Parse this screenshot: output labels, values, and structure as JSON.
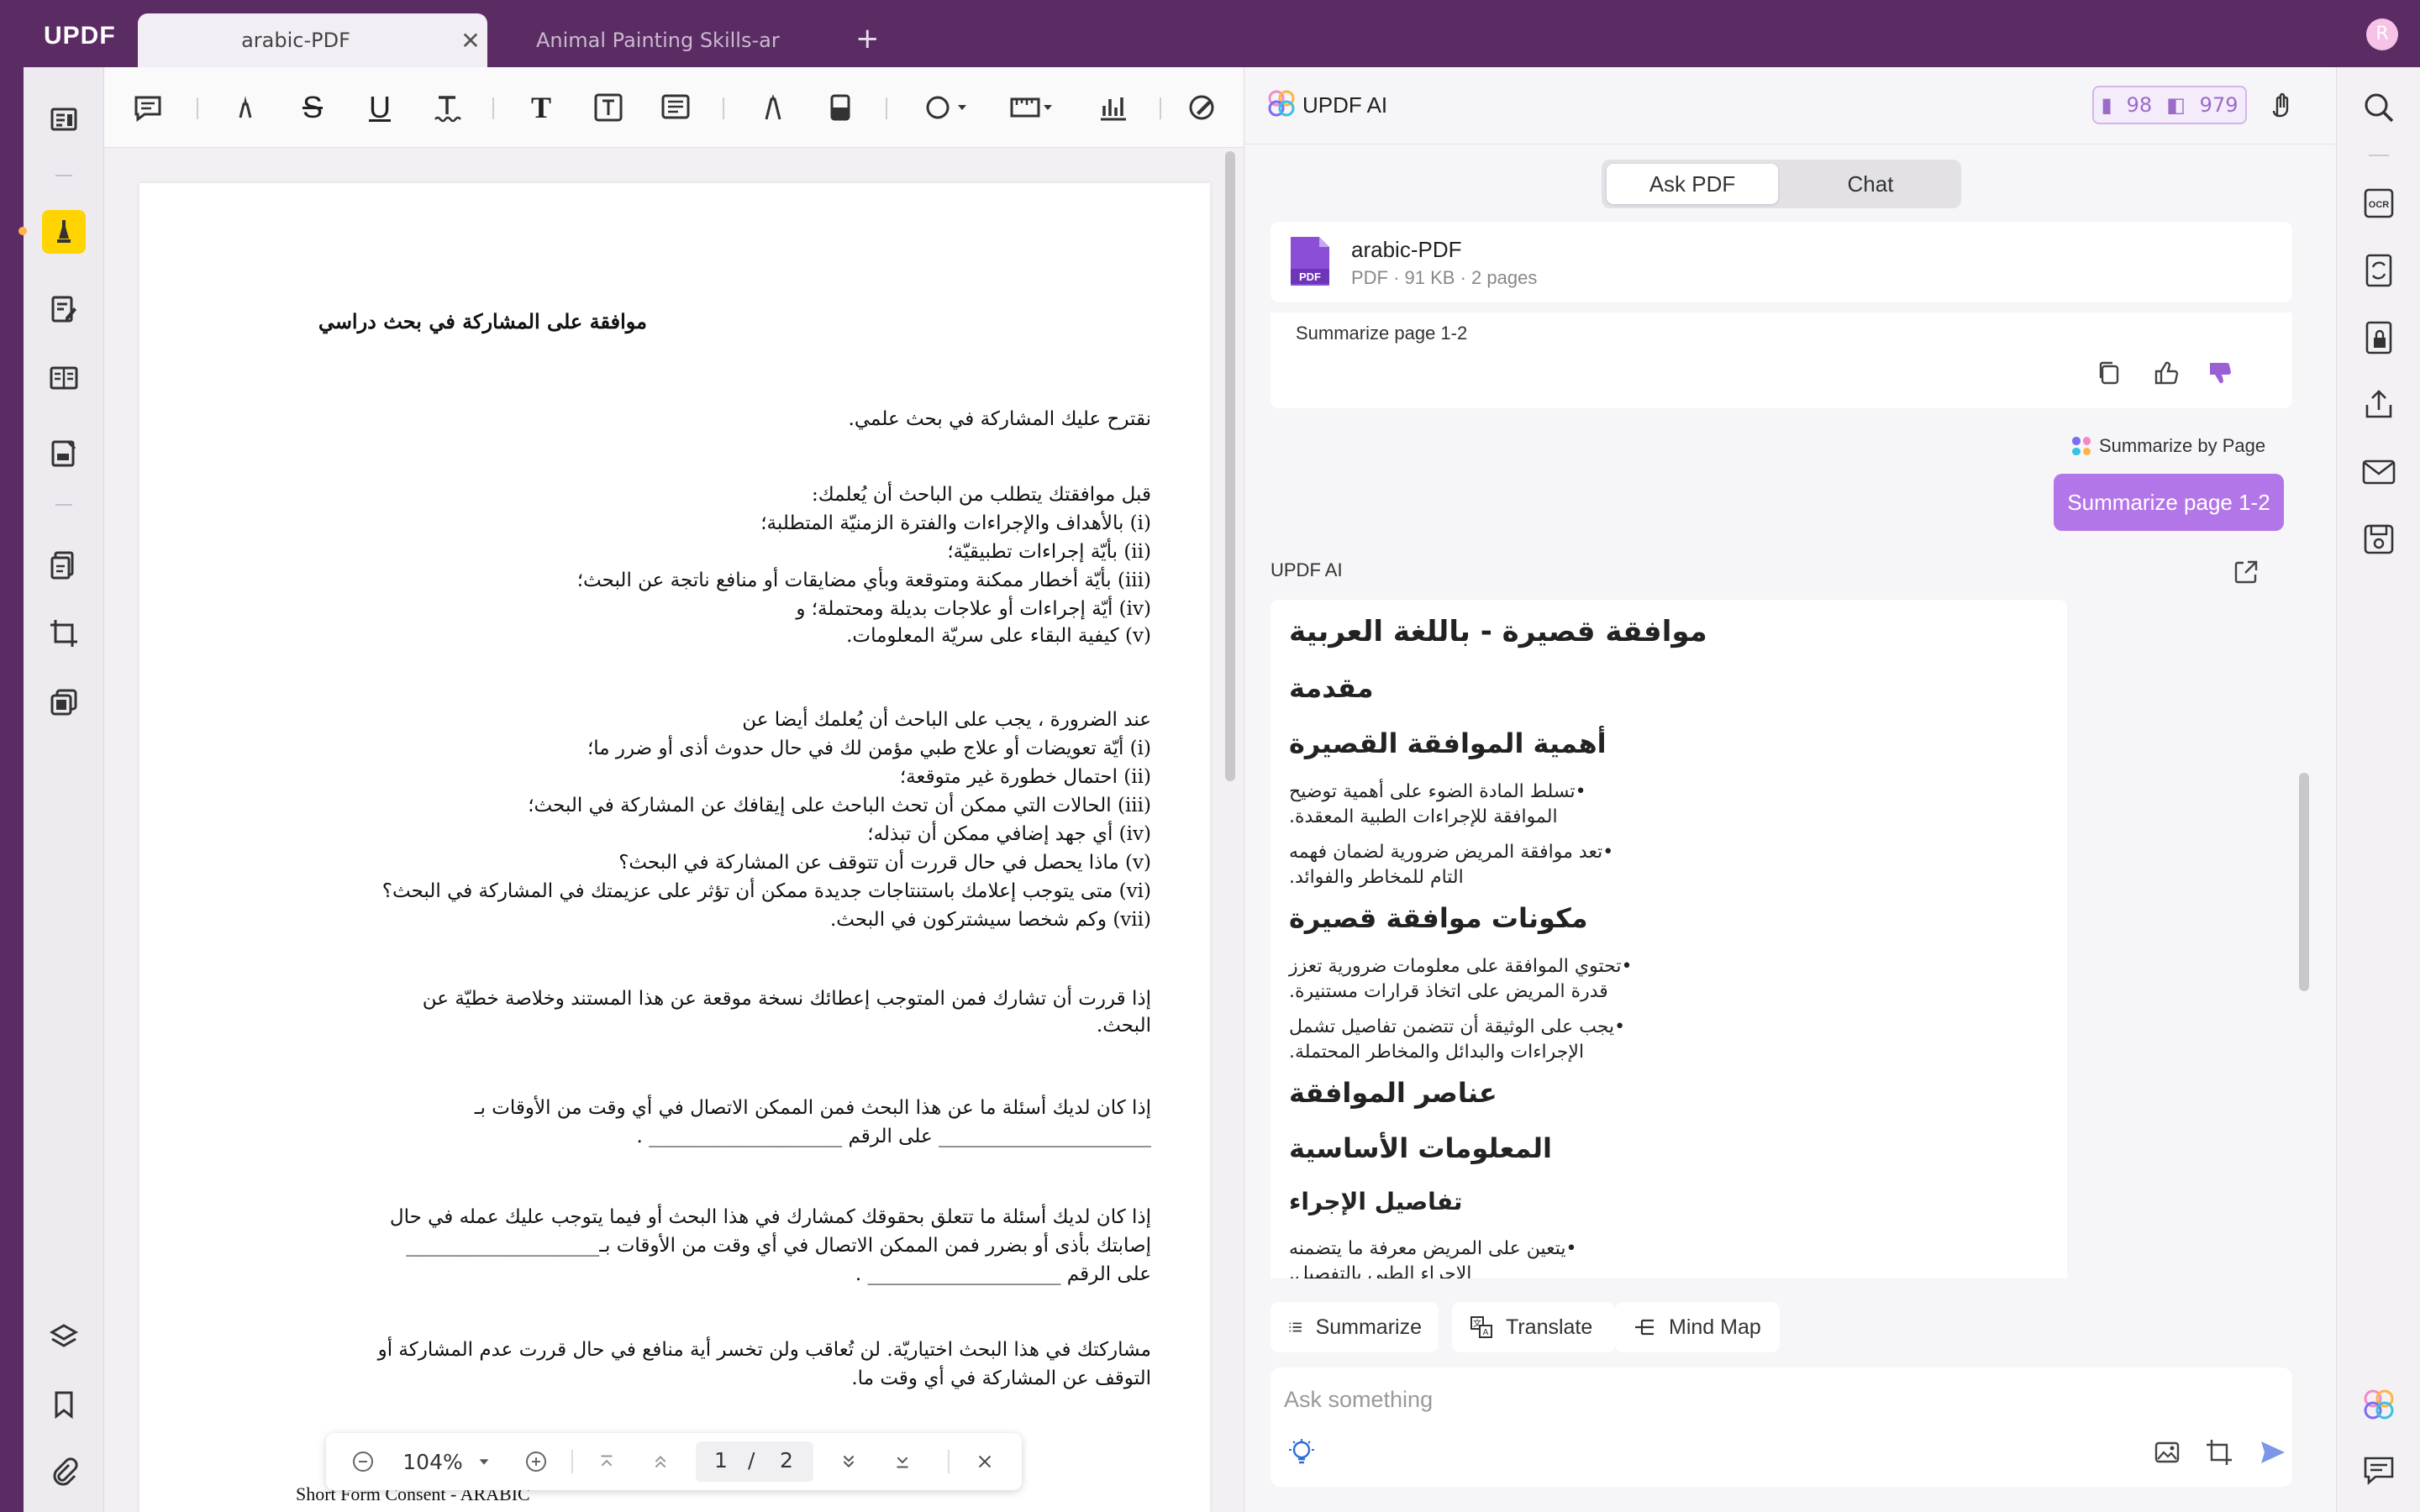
{
  "app": {
    "logo": "UPDF"
  },
  "tabs": [
    {
      "label": "arabic-PDF",
      "active": true
    },
    {
      "label": "Animal Painting Skills-ar",
      "active": false
    }
  ],
  "user": {
    "avatar_initial": "R"
  },
  "document": {
    "title": "موافقة على المشاركة في بحث دراسي",
    "lines": [
      "نقترح عليك المشاركة في بحث علمي.",
      "قبل موافقتك يتطلب من الباحث أن يُعلمك:",
      "(i) بالأهداف والإجراءات والفترة الزمنيّة المتطلبة؛",
      "(ii) بأيّة إجراءات تطبيقيّة؛",
      "(iii) بأيّة أخطار ممكنة ومتوقعة وبأي مضايقات أو منافع ناتجة عن البحث؛",
      "(iv) أيّة إجراءات أو علاجات بديلة ومحتملة؛ و",
      "(v) كيفية البقاء على سريّة المعلومات.",
      "عند الضرورة ، يجب على الباحث أن يُعلمك أيضا عن",
      "(i) أيّة تعويضات أو علاج طبي مؤمن لك في حال حدوث أذى أو ضرر ما؛",
      "(ii) احتمال خطورة غير متوقعة؛",
      "(iii) الحالات التي ممكن أن تحث الباحث على إيقافك عن المشاركة في البحث؛",
      "(iv) أي جهد إضافي ممكن أن تبذله؛",
      "(v) ماذا يحصل في حال قررت أن تتوقف عن المشاركة في البحث؟",
      "(vi) متى يتوجب إعلامك باستنتاجات جديدة ممكن أن تؤثر على عزيمتك في المشاركة في البحث؟",
      "(vii) وكم شخصا سيشتركون في البحث.",
      "إذا قررت أن تشارك فمن المتوجب إعطائك نسخة موقعة عن هذا المستند وخلاصة خطيّة عن",
      "البحث.",
      "إذا كان لديك أسئلة ما عن هذا البحث فمن الممكن الاتصال في أي وقت من الأوقات بـ",
      "______________________ على الرقم ____________________ .",
      "إذا كان لديك أسئلة ما تتعلق بحقوقك كمشارك في هذا البحث أو فيما يتوجب عليك عمله في حال",
      "إصابتك بأذى أو بضرر فمن الممكن الاتصال في أي وقت من الأوقات بـ____________________",
      "على الرقم ____________________ .",
      "مشاركتك في هذا البحث اختياريّة. لن تُعاقب ولن تخسر أية منافع في حال قررت عدم المشاركة أو",
      "التوقف عن المشاركة في أي وقت ما."
    ],
    "footer": "Short Form Consent - ARABIC"
  },
  "zoom": {
    "level": "104%",
    "current_page": "1",
    "separator": "/",
    "total_pages": "2"
  },
  "ai": {
    "title": "UPDF AI",
    "credits_a": "98",
    "credits_b": "979",
    "modes": {
      "ask_pdf": "Ask PDF",
      "chat": "Chat"
    },
    "file": {
      "name": "arabic-PDF",
      "meta": "PDF · 91 KB · 2 pages"
    },
    "prev_chip": "Summarize page 1-2",
    "summarize_by_page": "Summarize by Page",
    "user_message": "Summarize page 1-2",
    "ai_label": "UPDF AI",
    "answer": {
      "h1": "موافقة قصيرة - باللغة العربية",
      "intro": "مقدمة",
      "sec1": "أهمية الموافقة القصيرة",
      "p1a": "•تسلط المادة الضوء على أهمية توضيح",
      "p1b": "الموافقة للإجراءات الطبية المعقدة.",
      "p2a": "•تعد موافقة المريض ضرورية لضمان فهمه",
      "p2b": "التام للمخاطر والفوائد.",
      "sec2": "مكونات موافقة قصيرة",
      "p3a": "•تحتوي الموافقة على معلومات ضرورية تعزز",
      "p3b": "قدرة المريض على اتخاذ قرارات مستنيرة.",
      "p4a": "•يجب على الوثيقة أن تتضمن تفاصيل تشمل",
      "p4b": "الإجراءات والبدائل والمخاطر المحتملة.",
      "sec3": "عناصر الموافقة",
      "sec4": "المعلومات الأساسية",
      "sec5": "تفاصيل الإجراء",
      "p5a": "•يتعين على المريض معرفة ما يتضمنه",
      "p5b": "الإجراء الطبي بالتفصيل."
    },
    "actions": {
      "summarize": "Summarize",
      "translate": "Translate",
      "mind_map": "Mind Map"
    },
    "ask_placeholder": "Ask something"
  },
  "colors": {
    "brand": "#5b2c63",
    "accent": "#b376e8",
    "highlight": "#ffd400"
  }
}
